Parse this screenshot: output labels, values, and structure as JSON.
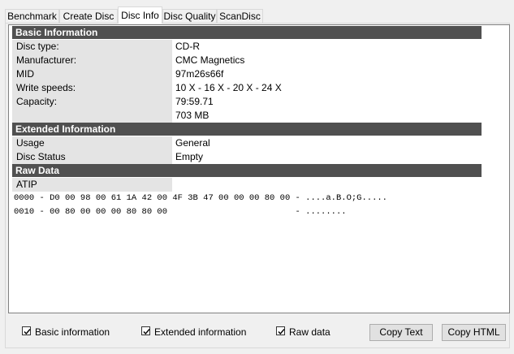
{
  "tabs": [
    "Benchmark",
    "Create Disc",
    "Disc Info",
    "Disc Quality",
    "ScanDisc"
  ],
  "sections": {
    "basic": {
      "title": "Basic Information",
      "rows": [
        {
          "k": "Disc type:",
          "v": "CD-R"
        },
        {
          "k": "Manufacturer:",
          "v": "CMC Magnetics"
        },
        {
          "k": "MID",
          "v": "97m26s66f"
        },
        {
          "k": "Write speeds:",
          "v": "10 X - 16 X - 20 X - 24 X"
        },
        {
          "k": "Capacity:",
          "v": "79:59.71"
        },
        {
          "k": "",
          "v": "703 MB"
        }
      ]
    },
    "extended": {
      "title": "Extended Information",
      "rows": [
        {
          "k": "Usage",
          "v": "General"
        },
        {
          "k": "Disc Status",
          "v": "Empty"
        }
      ]
    },
    "raw": {
      "title": "Raw Data",
      "label": "ATIP",
      "lines": [
        "0000 - D0 00 98 00 61 1A 42 00 4F 3B 47 00 00 00 80 00 - ....a.B.O;G.....",
        "0010 - 00 80 00 00 00 80 80 00                         - ........"
      ]
    }
  },
  "options": {
    "basic": "Basic information",
    "extended": "Extended information",
    "raw": "Raw data"
  },
  "buttons": {
    "copy_text": "Copy Text",
    "copy_html": "Copy HTML"
  },
  "colors": {
    "section_header": "#505050",
    "key_bg": "#e4e4e4"
  }
}
